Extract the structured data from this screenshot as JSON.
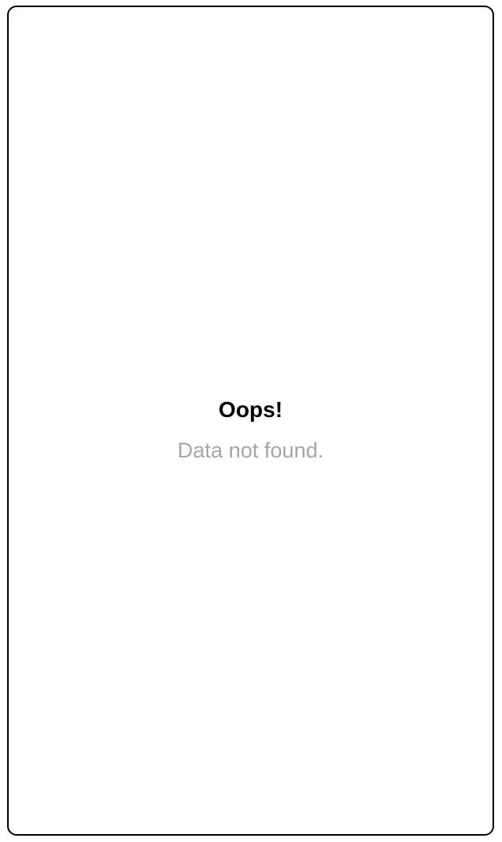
{
  "empty_state": {
    "title": "Oops!",
    "message": "Data not found."
  },
  "colors": {
    "border": "#000000",
    "title": "#000000",
    "message": "#a6a6a6",
    "background": "#ffffff"
  }
}
